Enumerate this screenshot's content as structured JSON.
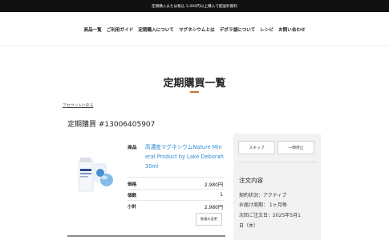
{
  "banner": {
    "text": "定期購入または税込 5,000円以上購入で配送料無料"
  },
  "nav": {
    "items": [
      "商品一覧",
      "ご利用ガイド",
      "定期購入について",
      "マグネシウムとは",
      "デボラ湖について",
      "レシピ",
      "お問い合わせ"
    ]
  },
  "page": {
    "title": "定期購買一覧",
    "back_link": "アカウントに戻る",
    "subscription_heading": "定期購買 #13006405907"
  },
  "product": {
    "label": "商品",
    "name": "高濃度マグネシウムNature Mineral Product by Lake Deborah 30ml",
    "rows": [
      {
        "label": "価格",
        "value": "2,980円"
      },
      {
        "label": "個数",
        "value": "1"
      },
      {
        "label": "小計",
        "value": "2,980円"
      }
    ],
    "change_qty_label": "数量の変更"
  },
  "side": {
    "skip_label": "スキップ",
    "pause_label": "一時停止",
    "order_heading": "注文内容",
    "status_line": "契約状況：アクティブ",
    "cycle_line": "お届け周期： 1ヶ月毎",
    "next_order_line1": "次回ご注文日：2025年5月1",
    "next_order_line2": "日（木）"
  },
  "colors": {
    "accent": "#c9732a",
    "link": "#2f8ad0",
    "banner_bg": "#111111"
  }
}
